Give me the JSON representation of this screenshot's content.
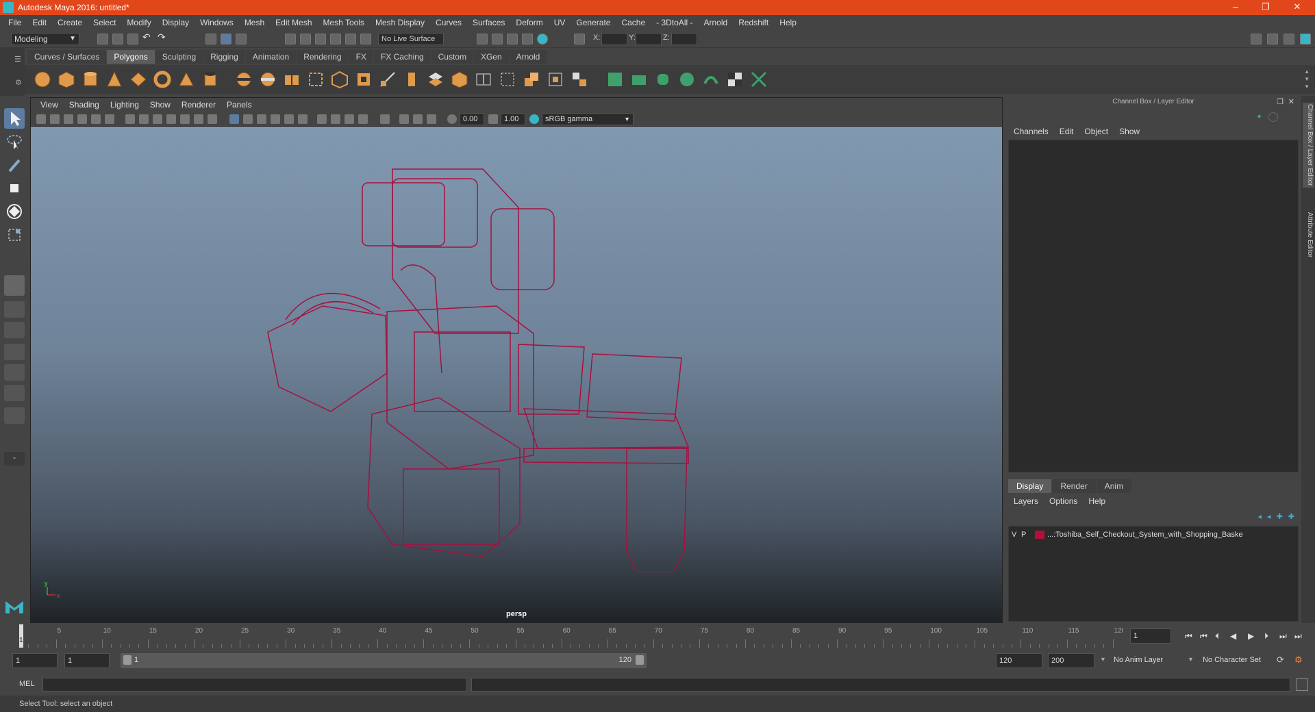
{
  "app": {
    "title": "Autodesk Maya 2016: untitled*"
  },
  "menubar": [
    "File",
    "Edit",
    "Create",
    "Select",
    "Modify",
    "Display",
    "Windows",
    "Mesh",
    "Edit Mesh",
    "Mesh Tools",
    "Mesh Display",
    "Curves",
    "Surfaces",
    "Deform",
    "UV",
    "Generate",
    "Cache",
    "- 3DtoAll -",
    "Arnold",
    "Redshift",
    "Help"
  ],
  "status": {
    "mode": "Modeling",
    "live_surface": "No Live Surface",
    "x_label": "X:",
    "y_label": "Y:",
    "z_label": "Z:"
  },
  "shelf_tabs": [
    "Curves / Surfaces",
    "Polygons",
    "Sculpting",
    "Rigging",
    "Animation",
    "Rendering",
    "FX",
    "FX Caching",
    "Custom",
    "XGen",
    "Arnold"
  ],
  "shelf_active": "Polygons",
  "viewport": {
    "menu": [
      "View",
      "Shading",
      "Lighting",
      "Show",
      "Renderer",
      "Panels"
    ],
    "exposure": "0.00",
    "gamma": "1.00",
    "colorspace": "sRGB gamma",
    "camera": "persp",
    "wire_color": "#a3123f"
  },
  "channel_box": {
    "title": "Channel Box / Layer Editor",
    "menu": [
      "Channels",
      "Edit",
      "Object",
      "Show"
    ]
  },
  "layer_editor": {
    "tabs": [
      "Display",
      "Render",
      "Anim"
    ],
    "active_tab": "Display",
    "menu": [
      "Layers",
      "Options",
      "Help"
    ],
    "layers": [
      {
        "v": "V",
        "p": "P",
        "name": "...:Toshiba_Self_Checkout_System_with_Shopping_Baske"
      }
    ]
  },
  "side_tabs": [
    "Channel Box / Layer Editor",
    "Attribute Editor"
  ],
  "timeline": {
    "ticks": [
      "5",
      "10",
      "15",
      "20",
      "25",
      "30",
      "35",
      "40",
      "45",
      "50",
      "55",
      "60",
      "65",
      "70",
      "75",
      "80",
      "85",
      "90",
      "95",
      "100",
      "105",
      "110",
      "115",
      "120"
    ],
    "current_frame_label": "1",
    "current_frame": "1"
  },
  "range": {
    "start": "1",
    "start_inner": "1",
    "range_start": "1",
    "range_end": "120",
    "end": "120",
    "end_outer": "200",
    "anim_layer": "No Anim Layer",
    "char_set": "No Character Set"
  },
  "mel": {
    "label": "MEL"
  },
  "statusbar": {
    "text": "Select Tool: select an object"
  }
}
